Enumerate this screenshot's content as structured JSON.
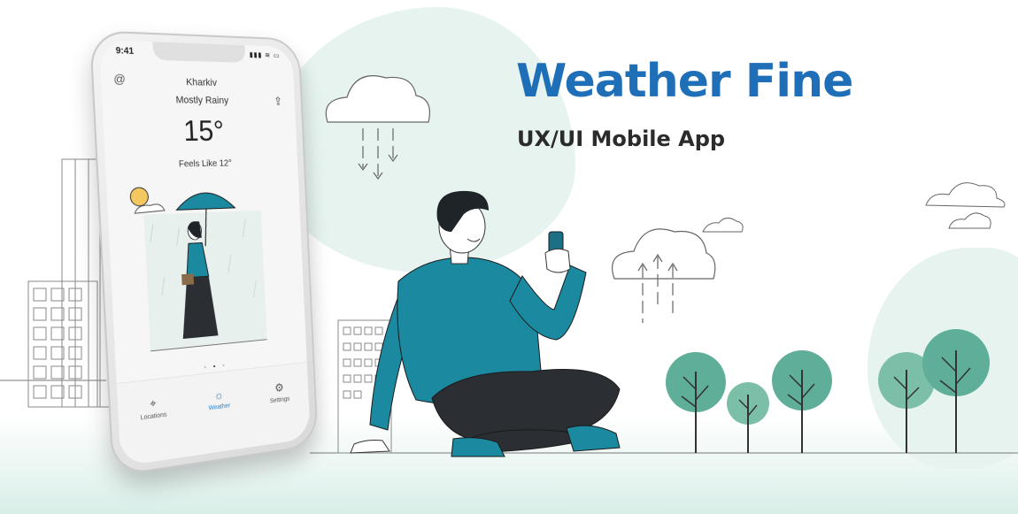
{
  "header": {
    "title": "Weather Fine",
    "subtitle": "UX/UI Mobile App"
  },
  "phone": {
    "status_time": "9:41",
    "status_icons": "▮▮▮ ≋ ▭",
    "brand_icon": "spiral-icon",
    "share_icon": "share-icon",
    "city": "Kharkiv",
    "condition": "Mostly Rainy",
    "temperature": "15°",
    "feels_like": "Feels Like 12°",
    "page_dots": [
      "•",
      "•",
      "•"
    ],
    "active_page": 1,
    "tabs": [
      {
        "label": "Locations",
        "icon": "location-pin-icon",
        "active": false
      },
      {
        "label": "Weather",
        "icon": "sun-icon",
        "active": true
      },
      {
        "label": "Settings",
        "icon": "gear-icon",
        "active": false
      }
    ]
  },
  "colors": {
    "title_blue": "#1f6fb8",
    "teal": "#1b8aa1",
    "tree_green": "#5fae99",
    "active_tab": "#2a83c9",
    "dark": "#2b2b2b"
  }
}
